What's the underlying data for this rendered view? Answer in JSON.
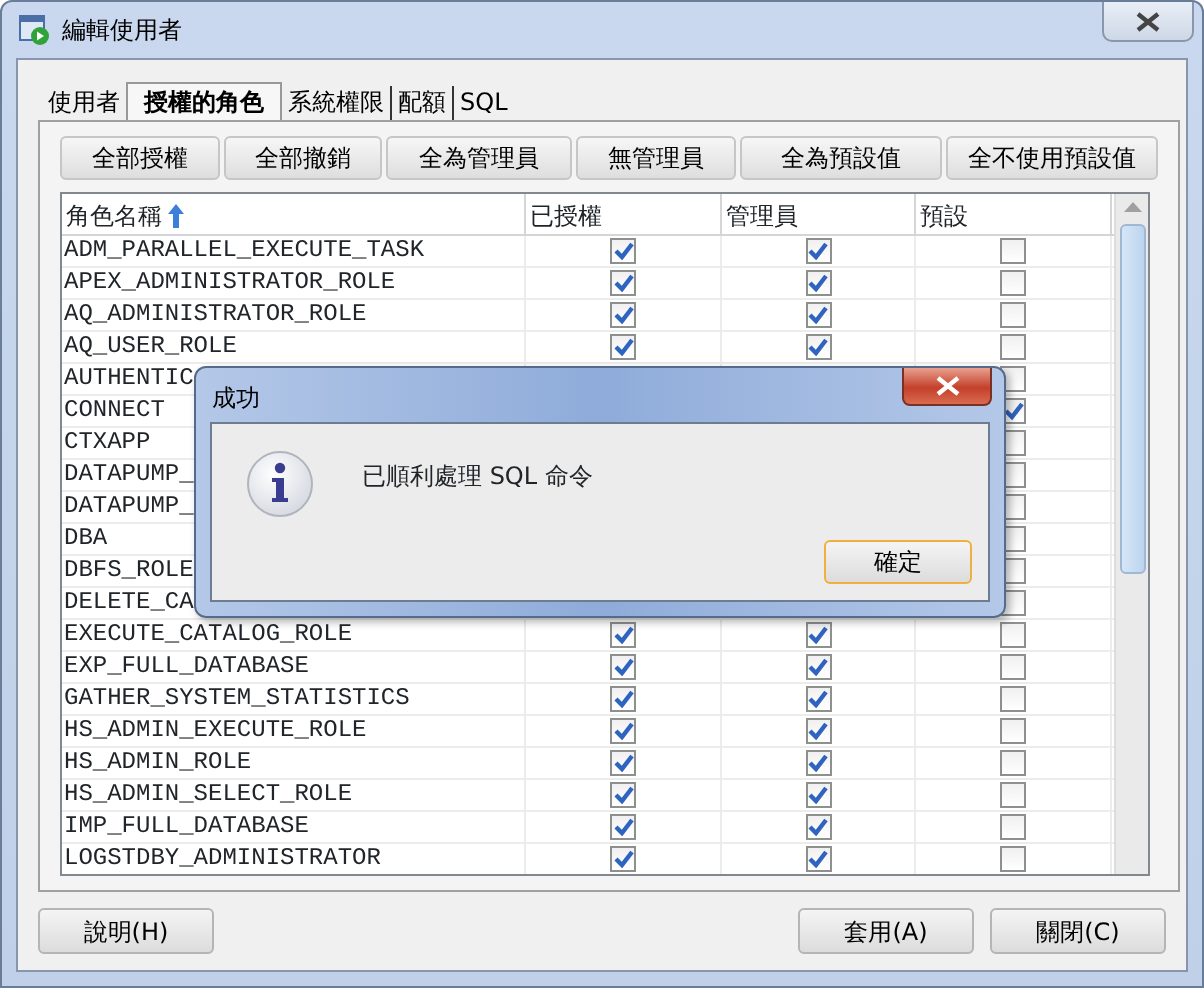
{
  "window": {
    "title": "編輯使用者"
  },
  "tabs": [
    {
      "label": "使用者",
      "selected": false
    },
    {
      "label": "授權的角色",
      "selected": true
    },
    {
      "label": "系統權限",
      "selected": false
    },
    {
      "label": "配額",
      "selected": false
    },
    {
      "label": "SQL",
      "selected": false
    }
  ],
  "actions": [
    "全部授權",
    "全部撤銷",
    "全為管理員",
    "無管理員",
    "全為預設值",
    "全不使用預設值"
  ],
  "table": {
    "columns": [
      "角色名稱",
      "已授權",
      "管理員",
      "預設"
    ],
    "rows": [
      {
        "name": "ADM_PARALLEL_EXECUTE_TASK",
        "granted": true,
        "admin": true,
        "default": false
      },
      {
        "name": "APEX_ADMINISTRATOR_ROLE",
        "granted": true,
        "admin": true,
        "default": false
      },
      {
        "name": "AQ_ADMINISTRATOR_ROLE",
        "granted": true,
        "admin": true,
        "default": false
      },
      {
        "name": "AQ_USER_ROLE",
        "granted": true,
        "admin": true,
        "default": false
      },
      {
        "name": "AUTHENTIC",
        "default": false
      },
      {
        "name": "CONNECT",
        "default": true
      },
      {
        "name": "CTXAPP",
        "default": false
      },
      {
        "name": "DATAPUMP_",
        "default": false
      },
      {
        "name": "DATAPUMP_",
        "default": false
      },
      {
        "name": "DBA",
        "default": false
      },
      {
        "name": "DBFS_ROLE",
        "default": false
      },
      {
        "name": "DELETE_CA",
        "default": false
      },
      {
        "name": "EXECUTE_CATALOG_ROLE",
        "granted": true,
        "admin": true,
        "default": false
      },
      {
        "name": "EXP_FULL_DATABASE",
        "granted": true,
        "admin": true,
        "default": false
      },
      {
        "name": "GATHER_SYSTEM_STATISTICS",
        "granted": true,
        "admin": true,
        "default": false
      },
      {
        "name": "HS_ADMIN_EXECUTE_ROLE",
        "granted": true,
        "admin": true,
        "default": false
      },
      {
        "name": "HS_ADMIN_ROLE",
        "granted": true,
        "admin": true,
        "default": false
      },
      {
        "name": "HS_ADMIN_SELECT_ROLE",
        "granted": true,
        "admin": true,
        "default": false
      },
      {
        "name": "IMP_FULL_DATABASE",
        "granted": true,
        "admin": true,
        "default": false
      },
      {
        "name": "LOGSTDBY_ADMINISTRATOR",
        "granted": true,
        "admin": true,
        "default": false
      }
    ]
  },
  "footer_buttons": [
    "說明(H)",
    "套用(A)",
    "關閉(C)"
  ],
  "dialog": {
    "title": "成功",
    "message": "已順利處理 SQL 命令",
    "ok": "確定"
  }
}
